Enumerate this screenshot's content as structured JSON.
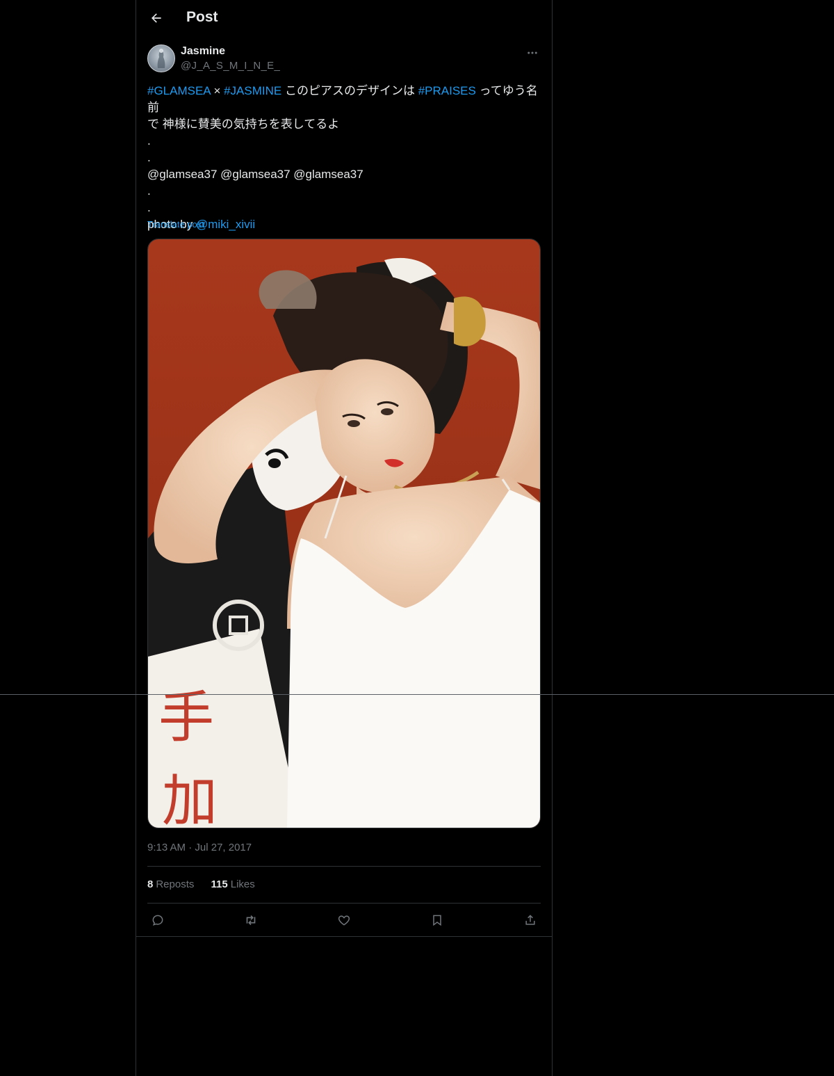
{
  "header": {
    "title": "Post"
  },
  "author": {
    "display_name": "Jasmine",
    "handle": "@J_A_S_M_I_N_E_"
  },
  "tweet": {
    "line1": {
      "tag1": "#GLAMSEA",
      "sep": " × ",
      "tag2": "#JASMINE",
      "text_a": " このピアスのデザインは ",
      "tag3": "#PRAISES",
      "text_b": " ってゆう名前"
    },
    "line2": "で 神様に賛美の気持ちを表してるよ",
    "dot1": ".",
    "dot2": ".",
    "mentions": "@glamsea37 @glamsea37 @glamsea37",
    "dot3": ".",
    "dot4": ".",
    "photo_by_prefix": "photo by ",
    "photo_by_handle": "@miki_xivii",
    "translate_label": "Translate post"
  },
  "meta": {
    "time": "9:13 AM",
    "sep": " · ",
    "date": "Jul 27, 2017"
  },
  "stats": {
    "reposts_count": "8",
    "reposts_label": "Reposts",
    "likes_count": "115",
    "likes_label": "Likes"
  },
  "actions": [
    {
      "icon": "reply-icon"
    },
    {
      "icon": "repost-icon"
    },
    {
      "icon": "like-icon"
    },
    {
      "icon": "bookmark-icon"
    },
    {
      "icon": "share-icon"
    }
  ],
  "media": {
    "painted_characters": [
      "手",
      "加"
    ]
  },
  "colors": {
    "background": "#000000",
    "text": "#e7e9ea",
    "secondary": "#71767b",
    "link": "#1d9bf0",
    "border": "#2f3336"
  }
}
